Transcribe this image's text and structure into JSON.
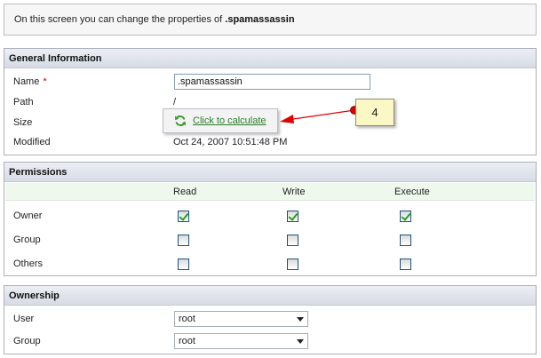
{
  "intro": {
    "prefix": "On this screen you can change the properties of ",
    "name": ".spamassassin"
  },
  "general": {
    "title": "General Information",
    "name_label": "Name",
    "required_mark": "*",
    "name_value": ".spamassassin",
    "path_label": "Path",
    "path_value": "/",
    "size_label": "Size",
    "modified_label": "Modified",
    "modified_value": "Oct 24, 2007 10:51:48 PM"
  },
  "calculate": {
    "label": "Click to calculate",
    "icon": "refresh-icon"
  },
  "callout": {
    "number": "4"
  },
  "permissions": {
    "title": "Permissions",
    "columns": [
      "Read",
      "Write",
      "Execute"
    ],
    "rows": [
      {
        "label": "Owner",
        "read": true,
        "write": true,
        "execute": true
      },
      {
        "label": "Group",
        "read": false,
        "write": false,
        "execute": false
      },
      {
        "label": "Others",
        "read": false,
        "write": false,
        "execute": false
      }
    ]
  },
  "ownership": {
    "title": "Ownership",
    "user_label": "User",
    "user_value": "root",
    "group_label": "Group",
    "group_value": "root"
  },
  "colors": {
    "header_bg": "#dde1ea",
    "perm_header_bg": "#eef8ec",
    "callout_bg": "#fbf8c6",
    "arrow": "#e00000",
    "link": "#2a7a2a"
  }
}
